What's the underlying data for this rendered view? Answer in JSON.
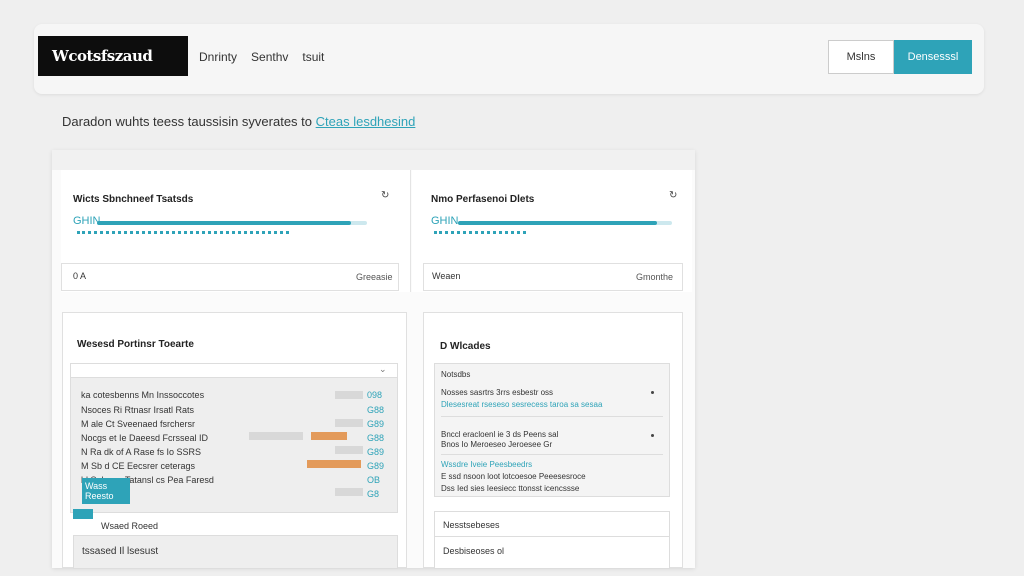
{
  "header": {
    "logo": "Wcotsfszaud",
    "nav": [
      "Dnrinty",
      "Senthv",
      "tsuit"
    ],
    "btn_outline": "Mslns",
    "btn_primary": "Densesssl"
  },
  "subline": {
    "text": "Daradon wuhts teess taussisin syverates to",
    "link": "Cteas lesdhesind"
  },
  "card1": {
    "title": "Wicts Sbnchneef Tsatsds",
    "bar_label": "GHIN",
    "bar_progress": 0.94,
    "foot_left": "0 A",
    "foot_right": "Greeasie"
  },
  "card2": {
    "title": "Nmo Perfasenoi Dlets",
    "bar_label": "GHIN",
    "bar_progress": 0.93,
    "foot_left": "Weaen",
    "foot_right": "Gmonthe"
  },
  "card3": {
    "title": "Wesesd Portinsr Toearte",
    "rows": [
      {
        "label": "ka cotesbenns Mn Inssoccotes",
        "value": "098"
      },
      {
        "label": "Nsoces Ri Rtnasr Irsatl Rats",
        "value": "G88"
      },
      {
        "label": "M ale Ct Sveenaed fsrchersr",
        "value": "G89"
      },
      {
        "label": "Nocgs et Ie Daeesd Fcrsseal ID",
        "value": "G88"
      },
      {
        "label": "N Ra dk of A Rase fs Io SSRS",
        "value": "G89"
      },
      {
        "label": "M Sb d CE Eecsrer ceterags",
        "value": "G89"
      },
      {
        "label": "hl Selsees Tatansl cs Pea Faresd",
        "value": "OB"
      },
      {
        "label": "",
        "value": "G8"
      }
    ],
    "tag": "Wass Reesto",
    "footer_label": "Wsaed Roeed",
    "footer_row": "tssased Il lsesust"
  },
  "card4": {
    "title": "D Wlcades",
    "list_header": "Notsdbs",
    "items": [
      "Nosses sasrtrs 3rrs esbestr oss",
      "Dlesesreat rseseso sesrecess taroa sa sesaa",
      "Bnccl eracloenl ie 3 ds Peens sal",
      "Bnos Io Meroeseo Jeroesee Gr",
      "Wssdre Iveie Peesbeedrs",
      "E ssd nsoon loot lotcoesoe Peeesesroce",
      "Dss Ied sies Ieesiecc ttonsst icencssse"
    ],
    "footer_label": "Nesstsebeses",
    "footer_row": "Desbiseoses ol"
  }
}
